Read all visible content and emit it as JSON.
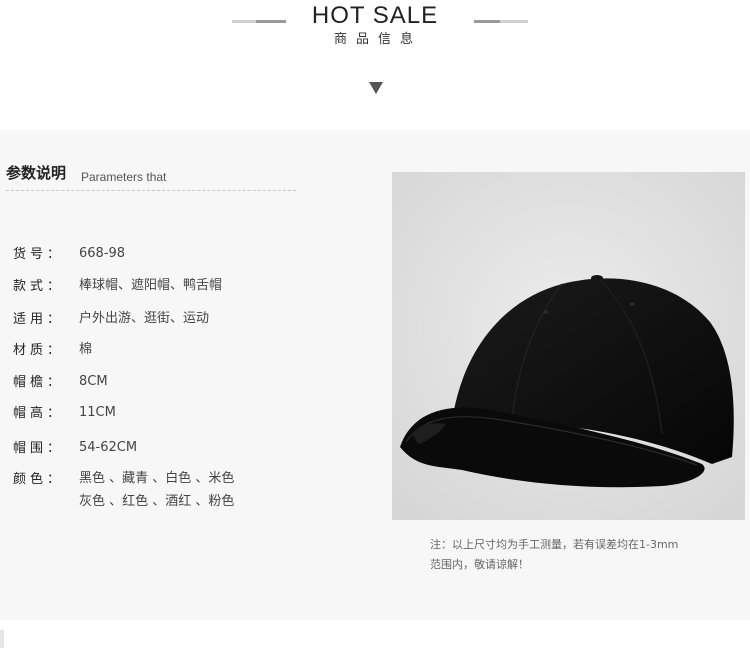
{
  "header": {
    "title": "HOT SALE",
    "subtitle": "商品信息",
    "arrow_icon": "triangle-down-icon"
  },
  "section": {
    "title": "参数说明",
    "subtitle": "Parameters that"
  },
  "specs": [
    {
      "label": "货号：",
      "value": "668-98"
    },
    {
      "label": "款式：",
      "value": "棒球帽、遮阳帽、鸭舌帽"
    },
    {
      "label": "适用：",
      "value": "户外出游、逛街、运动"
    },
    {
      "label": "材质：",
      "value": "棉"
    },
    {
      "label": "帽檐：",
      "value": "8CM"
    },
    {
      "label": "帽高：",
      "value": "11CM"
    },
    {
      "label": "帽围：",
      "value": "54-62CM"
    },
    {
      "label": "颜色：",
      "value_line1": "黑色 、藏青 、白色 、米色",
      "value_line2": "灰色 、红色 、酒红 、粉色"
    }
  ],
  "note": {
    "line1": "注：以上尺寸均为手工测量，若有误差均在1-3mm",
    "line2": "范围内，敬请谅解！"
  },
  "colors": {
    "background": "#f7f7f7",
    "cap": "#0c0c0c",
    "photo_background": "#e2e2e2"
  }
}
